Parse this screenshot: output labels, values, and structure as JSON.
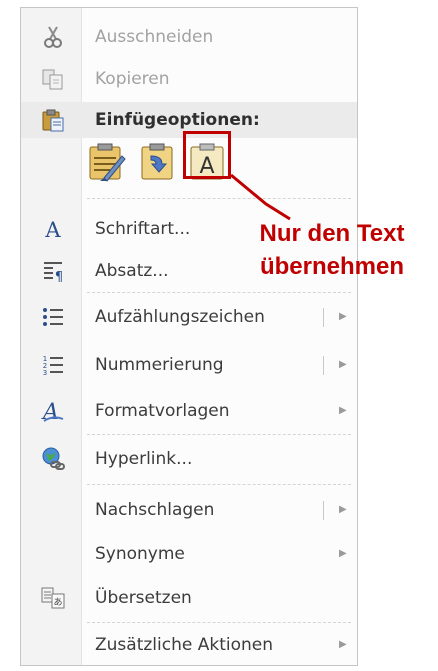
{
  "menu": {
    "cut": "Ausschneiden",
    "copy": "Kopieren",
    "paste_options": "Einfügeoptionen:",
    "font": "Schriftart...",
    "paragraph": "Absatz...",
    "bullets": "Aufzählungszeichen",
    "numbering": "Nummerierung",
    "styles": "Formatvorlagen",
    "hyperlink": "Hyperlink...",
    "lookup": "Nachschlagen",
    "synonyms": "Synonyme",
    "translate": "Übersetzen",
    "additional_actions": "Zusätzliche Aktionen"
  },
  "paste_buttons": {
    "text_only_glyph": "A"
  },
  "annotation": {
    "line1": "Nur den Text",
    "line2": "übernehmen",
    "color": "#c00000"
  },
  "icons": {
    "cut": "scissors-icon",
    "copy": "copy-icon",
    "paste": "clipboard-icon",
    "keep_source_formatting": "paste-keep-formatting-icon",
    "merge_formatting": "paste-merge-formatting-icon",
    "keep_text_only": "paste-text-only-icon",
    "font": "font-icon",
    "paragraph": "paragraph-icon",
    "bullets": "bullet-list-icon",
    "numbering": "numbered-list-icon",
    "styles": "styles-icon",
    "hyperlink": "globe-link-icon",
    "translate": "translate-icon",
    "submenu": "submenu-arrow-icon"
  },
  "submenu_arrow": "▶"
}
